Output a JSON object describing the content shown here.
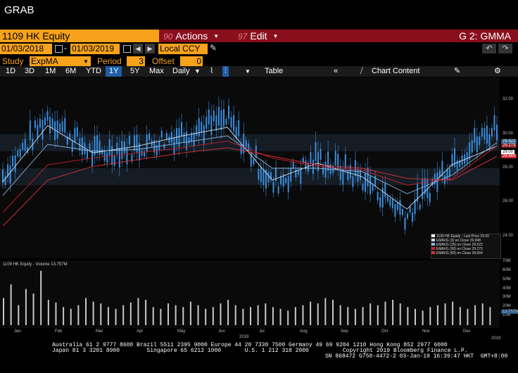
{
  "window_title": "GRAB",
  "header": {
    "ticker": "1109 HK Equity",
    "actions": {
      "num": "90",
      "label": "Actions"
    },
    "edit": {
      "num": "97",
      "label": "Edit"
    },
    "graph_label": "G 2: GMMA"
  },
  "dates": {
    "start": "01/03/2018",
    "end": "01/03/2019",
    "currency": "Local CCY"
  },
  "study": {
    "label": "Study",
    "value": "ExpMA",
    "period_label": "Period",
    "period": "3",
    "offset_label": "Offset",
    "offset": "0"
  },
  "periods": [
    "1D",
    "3D",
    "1M",
    "6M",
    "YTD",
    "1Y",
    "5Y",
    "Max"
  ],
  "selected_period": "1Y",
  "frequency": "Daily",
  "table_label": "Table",
  "chart_content_label": "Chart Content",
  "colors": {
    "orange": "#f7a21b",
    "red_bar": "#8a0f1c",
    "candle": "#3a8fe0",
    "ema_fast": "#8ab4d8",
    "ema_slow": "#e0303a"
  },
  "chart_data": {
    "type": "line",
    "x": [
      "2018-01",
      "2018-02",
      "2018-03",
      "2018-04",
      "2018-05",
      "2018-06",
      "2018-07",
      "2018-08",
      "2018-09",
      "2018-10",
      "2018-11",
      "2018-12"
    ],
    "series": [
      {
        "name": "1109 HK Equity - Last Price 29.00",
        "values": [
          27.5,
          31.0,
          28.8,
          29.2,
          30.0,
          30.8,
          27.0,
          28.5,
          27.4,
          25.2,
          28.4,
          30.4
        ]
      },
      {
        "name": "EMAVG (3) on Close",
        "values": [
          27.2,
          30.5,
          28.9,
          29.3,
          29.9,
          30.4,
          27.3,
          28.3,
          27.5,
          25.6,
          28.2,
          29.3
        ]
      },
      {
        "name": "EMAVG (15) on Close",
        "values": [
          26.4,
          29.4,
          29.0,
          29.1,
          29.5,
          29.9,
          28.0,
          28.0,
          27.8,
          26.5,
          27.6,
          29.5
        ]
      },
      {
        "name": "EMAVG (30) on Close",
        "values": [
          25.4,
          28.2,
          28.6,
          28.9,
          29.2,
          29.6,
          28.6,
          28.1,
          27.9,
          27.0,
          27.4,
          29.3
        ]
      },
      {
        "name": "EMAVG (60) on Close",
        "values": [
          24.6,
          27.3,
          28.1,
          28.5,
          28.9,
          29.2,
          28.7,
          28.2,
          28.0,
          27.4,
          27.3,
          28.7
        ]
      }
    ],
    "legend": [
      "1109 HK Equity - Last Price 29.00",
      "EMAVG (3) on Close 29.048",
      "EMAVG (15) on Close 29.522",
      "EMAVG (30) on Close 29.273",
      "EMAVG (60) on Close 28.664"
    ],
    "yticks": [
      "32.00",
      "30.00",
      "28.00",
      "26.00",
      "24.00"
    ],
    "ylim": [
      23,
      33
    ],
    "last_values": [
      "29.522",
      "29.273",
      "29.00",
      "28.664"
    ],
    "xlabels": [
      "Jan",
      "Feb",
      "Mar",
      "Apr",
      "May",
      "Jun",
      "Jul",
      "Aug",
      "Sep",
      "Oct",
      "Nov",
      "Dec"
    ],
    "year_labels": [
      "2018",
      "2019"
    ],
    "volume": {
      "label": "1109 HK Equity - Volume 13.757M",
      "yticks": [
        "70M",
        "60M",
        "50M",
        "40M",
        "30M",
        "20M",
        "10M"
      ],
      "last": "13.757M",
      "values": [
        30,
        45,
        22,
        40,
        35,
        60,
        28,
        25,
        20,
        18,
        22,
        30,
        26,
        24,
        20,
        18,
        22,
        25,
        30,
        28,
        20,
        18,
        24,
        22,
        20,
        26,
        22,
        18,
        20,
        24,
        28,
        22,
        18,
        20,
        22,
        24,
        20,
        18,
        16,
        20,
        22,
        26,
        24,
        30,
        28,
        22,
        20,
        18,
        20,
        24,
        22,
        26,
        28,
        24,
        20,
        18,
        16,
        20,
        22,
        24,
        26,
        20,
        18,
        22,
        24,
        20
      ]
    }
  },
  "footer": {
    "line1": "Australia 61 2 9777 8600 Brazil 5511 2395 9000 Europe 44 20 7330 7500 Germany 49 69 9204 1210 Hong Kong 852 2977 6000",
    "line2": "Japan 81 3 3201 8900        Singapore 65 6212 1000       U.S. 1 212 318 2000          Copyright 2019 Bloomberg Finance L.P.",
    "line3": "SN 868472 G750-4472-2 03-Jan-19 16:39:47 HKT  GMT+8:00"
  }
}
